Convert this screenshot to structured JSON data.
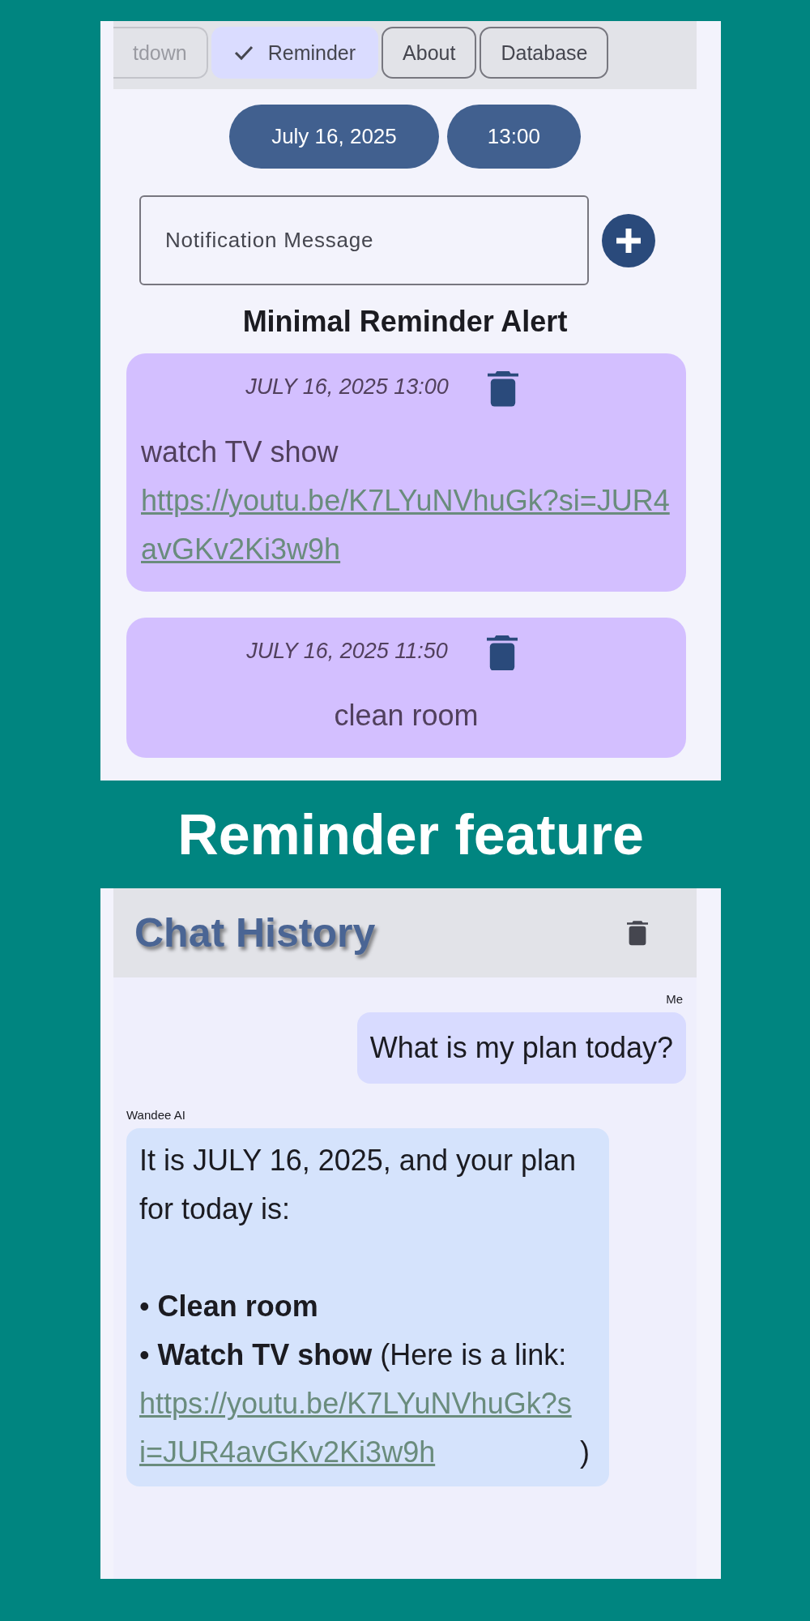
{
  "reminder_screen": {
    "tabs": [
      {
        "label": "tdown",
        "selected": false
      },
      {
        "label": "Reminder",
        "selected": true
      },
      {
        "label": "About",
        "selected": false
      },
      {
        "label": "Database",
        "selected": false
      }
    ],
    "date_button": "July 16, 2025",
    "time_button": "13:00",
    "message_field": {
      "placeholder": "Notification Message"
    },
    "list_title": "Minimal Reminder Alert",
    "reminders": [
      {
        "datetime": "JULY 16, 2025 13:00",
        "text": "watch TV show",
        "link": "https://youtu.be/K7LYuNVhuGk?si=JUR4avGKv2Ki3w9h"
      },
      {
        "datetime": "JULY 16, 2025 11:50",
        "text": "clean room"
      }
    ]
  },
  "caption": "Reminder feature",
  "chat_screen": {
    "title": "Chat History",
    "messages": [
      {
        "kind": "user",
        "sender": "Me",
        "lines": [
          {
            "text": "What is my plan today?"
          }
        ]
      },
      {
        "kind": "assistant",
        "sender": "Wandee AI",
        "lines": [
          {
            "text": "It is JULY 16, 2025, and your plan for today is:"
          },
          {
            "text": "• **Clean room**"
          },
          {
            "text": "• **Watch TV show** (Here is a link:",
            "link": "https://youtu.be/K7LYuNVhuGk?si=JUR4avGKv2Ki3w9h",
            "after": ")"
          }
        ]
      }
    ]
  }
}
